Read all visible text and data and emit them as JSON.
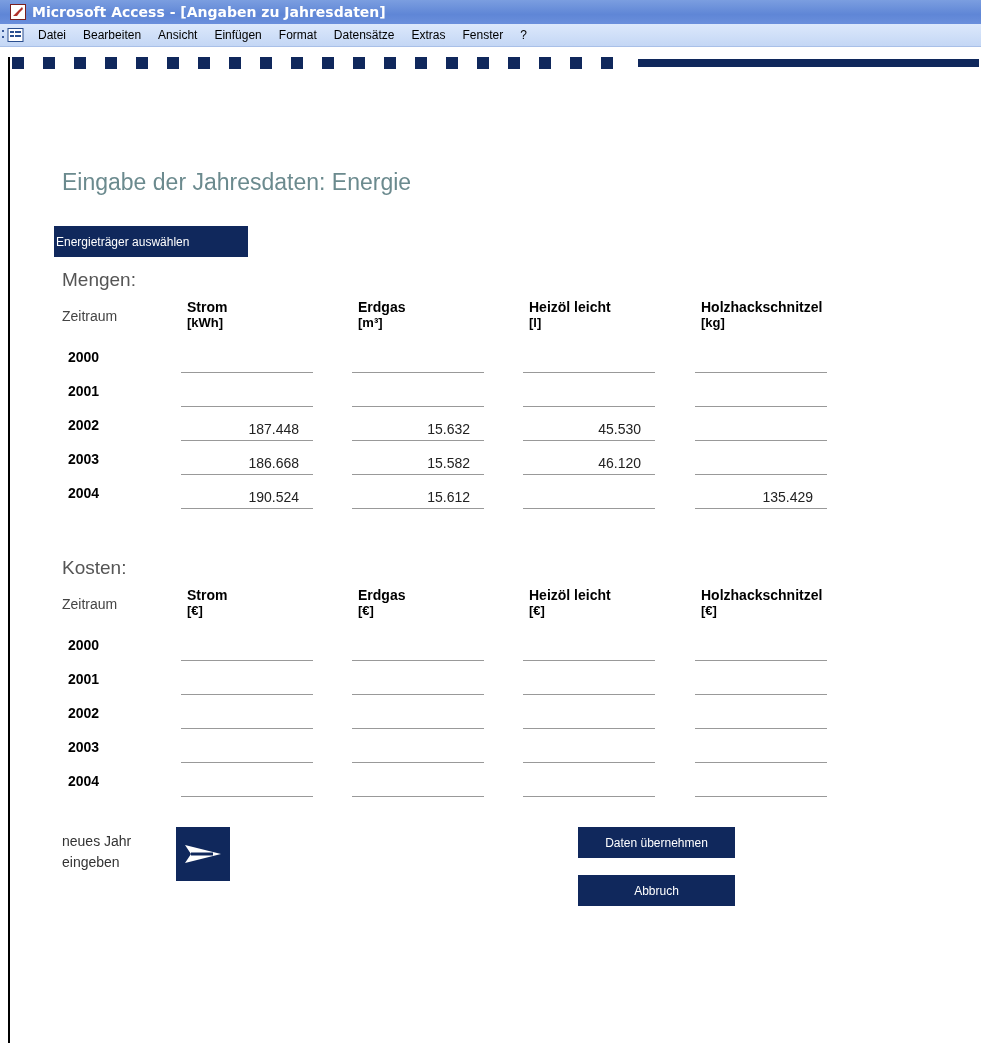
{
  "window": {
    "title": "Microsoft Access - [Angaben zu Jahresdaten]"
  },
  "menu": [
    "Datei",
    "Bearbeiten",
    "Ansicht",
    "Einfügen",
    "Format",
    "Datensätze",
    "Extras",
    "Fenster",
    "?"
  ],
  "form": {
    "heading": "Eingabe der Jahresdaten: Energie",
    "select_button": "Energieträger auswählen",
    "sections": [
      {
        "label": "Mengen:",
        "period_header": "Zeitraum",
        "columns": [
          {
            "name": "Strom",
            "unit": "[kWh]"
          },
          {
            "name": "Erdgas",
            "unit": "[m³]"
          },
          {
            "name": "Heizöl leicht",
            "unit": "[l]"
          },
          {
            "name": "Holzhackschnitzel",
            "unit": "[kg]"
          }
        ],
        "rows": [
          {
            "year": "2000"
          },
          {
            "year": "2001"
          },
          {
            "year": "2002",
            "values": {
              "0": "187.448",
              "1": "15.632",
              "2": "45.530"
            }
          },
          {
            "year": "2003",
            "values": {
              "0": "186.668",
              "1": "15.582",
              "2": "46.120"
            }
          },
          {
            "year": "2004",
            "values": {
              "0": "190.524",
              "1": "15.612",
              "3": "135.429"
            }
          }
        ]
      },
      {
        "label": "Kosten:",
        "period_header": "Zeitraum",
        "columns": [
          {
            "name": "Strom",
            "unit": "[€]"
          },
          {
            "name": "Erdgas",
            "unit": "[€]"
          },
          {
            "name": "Heizöl leicht",
            "unit": "[€]"
          },
          {
            "name": "Holzhackschnitzel",
            "unit": "[€]"
          }
        ],
        "rows": [
          {
            "year": "2000"
          },
          {
            "year": "2001"
          },
          {
            "year": "2002"
          },
          {
            "year": "2003"
          },
          {
            "year": "2004"
          }
        ]
      }
    ],
    "new_year_label": "neues Jahr eingeben",
    "apply_button": "Daten übernehmen",
    "cancel_button": "Abbruch"
  }
}
